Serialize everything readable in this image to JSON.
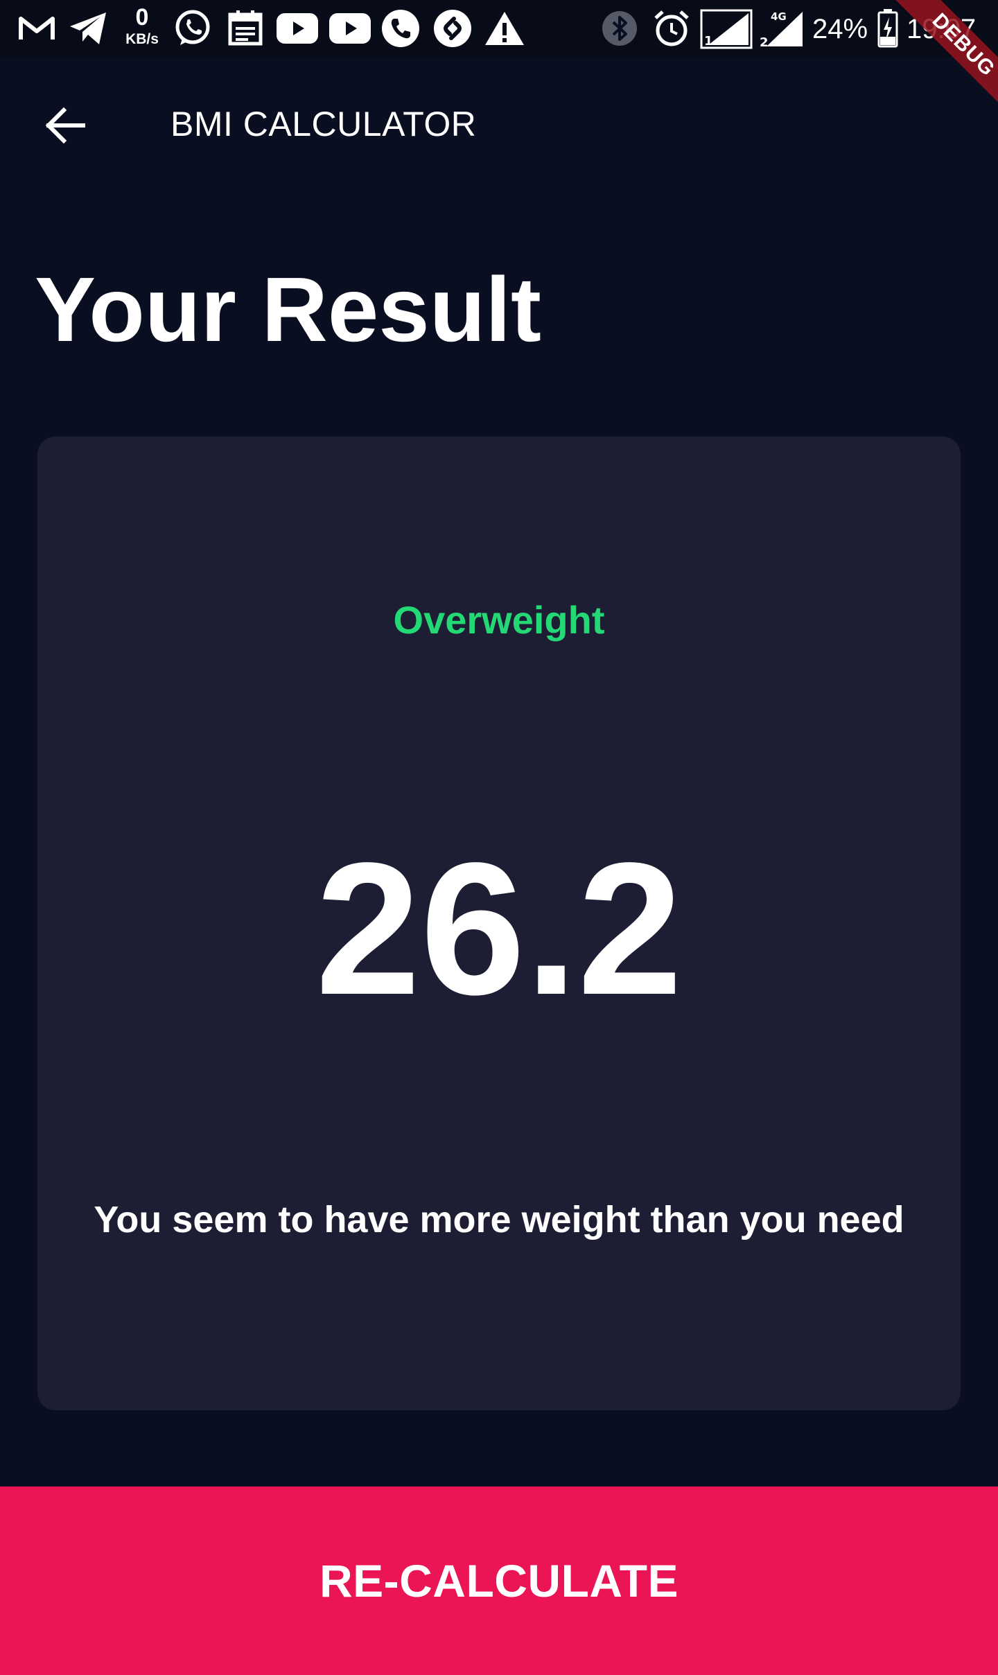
{
  "status_bar": {
    "net_speed_value": "0",
    "net_speed_unit": "KB/s",
    "battery": "24%",
    "time": "19:07",
    "sim1_label": "1",
    "sim2_label": "2",
    "network_type": "4G",
    "left_icons": [
      "gmail-icon",
      "telegram-icon",
      "whatsapp-icon",
      "calendar-icon",
      "youtube-icon",
      "youtube-icon",
      "phone-icon",
      "shazam-icon",
      "warning-icon"
    ],
    "right_icons": [
      "bluetooth-icon",
      "alarm-icon",
      "signal-sim1-icon",
      "signal-sim2-icon",
      "battery-charging-icon"
    ]
  },
  "debug_banner": "DEBUG",
  "app_bar": {
    "title": "BMI CALCULATOR",
    "back_icon": "arrow-back-icon"
  },
  "page": {
    "title": "Your Result"
  },
  "result": {
    "status": "Overweight",
    "bmi": "26.2",
    "message": "You seem to have more weight than you need"
  },
  "action": {
    "label": "RE-CALCULATE"
  },
  "colors": {
    "background": "#0a0e21",
    "card": "#1d1e33",
    "status_green": "#24d876",
    "accent": "#eb1555",
    "text": "#ffffff"
  }
}
